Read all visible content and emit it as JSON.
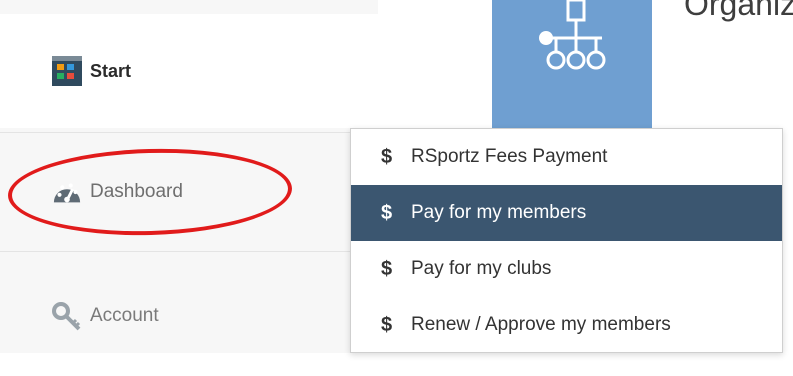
{
  "sidebar": {
    "items": [
      {
        "label": "Start",
        "icon": "start-grid-icon"
      },
      {
        "label": "Dashboard",
        "icon": "speedometer-icon"
      },
      {
        "label": "Account",
        "icon": "key-icon"
      }
    ]
  },
  "header": {
    "title": "Organiz",
    "tile_icon": "org-chart-icon"
  },
  "menu": {
    "items": [
      {
        "symbol": "$",
        "label": "RSportz Fees Payment"
      },
      {
        "symbol": "$",
        "label": "Pay for my members",
        "active": true
      },
      {
        "symbol": "$",
        "label": "Pay for my clubs"
      },
      {
        "symbol": "$",
        "label": "Renew / Approve my members"
      }
    ]
  },
  "colors": {
    "active_menu": "#3b5670",
    "tile": "#6f9fd1",
    "highlight_ellipse": "#e11b1b"
  }
}
